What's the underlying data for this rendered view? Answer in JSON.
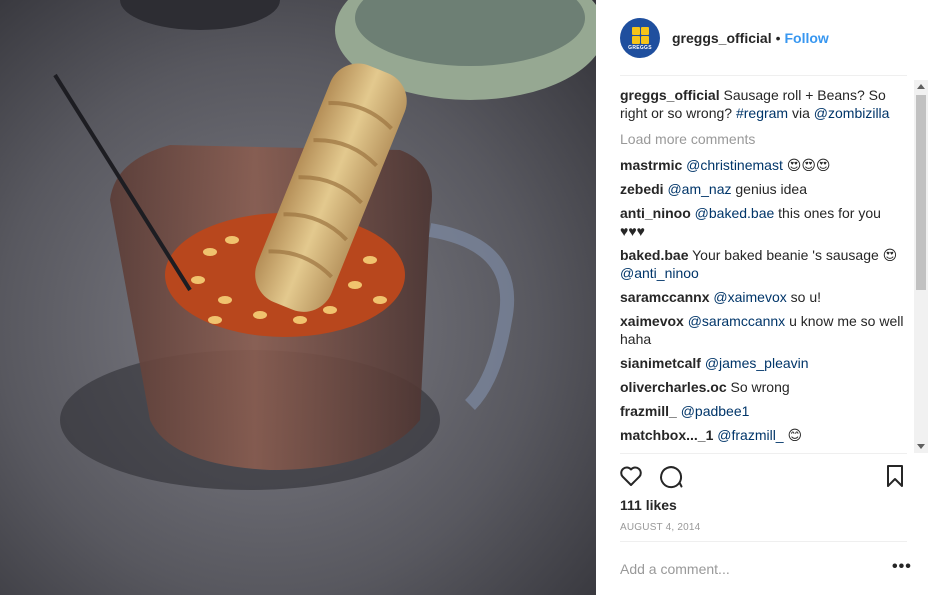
{
  "post": {
    "username": "greggs_official",
    "follow_label": "Follow",
    "avatar_brand": "GREGGS",
    "caption_user": "greggs_official",
    "caption_text": "Sausage roll + Beans? So right or so wrong?",
    "caption_hashtag": "#regram",
    "caption_via": "via",
    "caption_mention": "@zombizilla",
    "load_more": "Load more comments",
    "likes": "111 likes",
    "date": "AUGUST 4, 2014",
    "add_comment_placeholder": "Add a comment...",
    "more_label": "•••"
  },
  "comments": [
    {
      "user": "mastrmic",
      "mention": "@christinemast",
      "text": "😍😍😍"
    },
    {
      "user": "zebedi",
      "mention": "@am_naz",
      "text": "genius idea"
    },
    {
      "user": "anti_ninoo",
      "mention": "@baked.bae",
      "text": "this ones for you ♥♥♥"
    },
    {
      "user": "baked.bae",
      "mention": "",
      "text": "Your baked beanie 's sausage 😍",
      "mention_after": "@anti_ninoo"
    },
    {
      "user": "saramccannx",
      "mention": "@xaimevox",
      "text": "so u!"
    },
    {
      "user": "xaimevox",
      "mention": "@saramccannx",
      "text": "u know me so well haha"
    },
    {
      "user": "sianimetcalf",
      "mention": "@james_pleavin",
      "text": ""
    },
    {
      "user": "olivercharles.oc",
      "mention": "",
      "text": "So wrong"
    },
    {
      "user": "frazmill_",
      "mention": "@padbee1",
      "text": ""
    },
    {
      "user": "matchbox..._1",
      "mention": "@frazmill_",
      "text": "😊"
    }
  ],
  "icons": {
    "heart": "heart-icon",
    "comment": "comment-icon",
    "bookmark": "bookmark-icon"
  },
  "colors": {
    "link": "#3897f0",
    "mention": "#003569",
    "muted": "#999999"
  }
}
